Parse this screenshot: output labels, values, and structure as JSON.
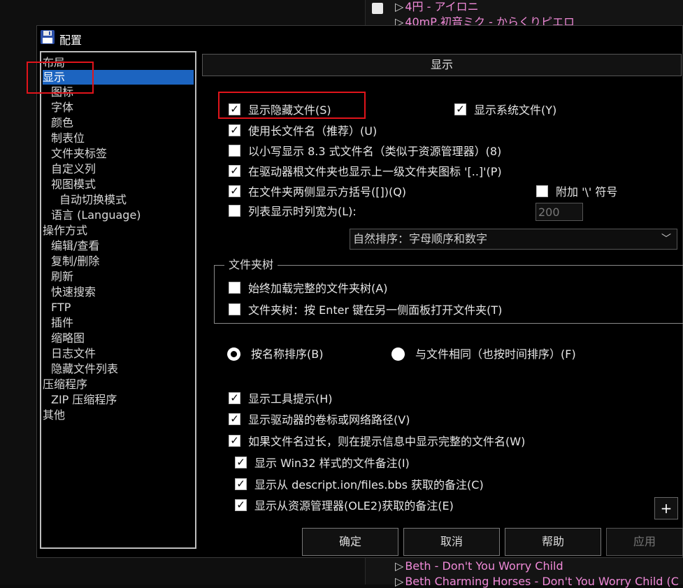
{
  "background": {
    "tracks_top": [
      "4円 - アイロニ",
      "40mP,初音ミク - からくりピエロ"
    ],
    "tracks_bottom": [
      "Beth - Don't You Worry Child",
      "Beth Charming Horses - Don't You Worry Child (C"
    ]
  },
  "dialog": {
    "title": "配置",
    "tree": [
      "布局",
      "显示",
      "图标",
      "字体",
      "颜色",
      "制表位",
      "文件夹标签",
      "自定义列",
      "视图模式",
      "自动切换模式",
      "语言 (Language)",
      "操作方式",
      "编辑/查看",
      "复制/删除",
      "刷新",
      "快速搜索",
      "FTP",
      "插件",
      "缩略图",
      "日志文件",
      "隐藏文件列表",
      "压缩程序",
      "ZIP 压缩程序",
      "其他"
    ],
    "panel_title": "显示",
    "options": {
      "show_hidden": "显示隐藏文件(S)",
      "show_system": "显示系统文件(Y)",
      "long_names": "使用长文件名（推荐）(U)",
      "lowercase_83": "以小写显示 8.3 式文件名（类似于资源管理器）(8)",
      "parent_icon": "在驱动器根文件夹也显示上一级文件夹图标 '[..]'(P)",
      "brackets": "在文件夹两侧显示方括号([])(Q)",
      "append_backslash": "附加 '\\' 符号",
      "col_width": "列表显示时列宽为(L):",
      "col_width_value": "200",
      "sort_mode": "自然排序：字母顺序和数字",
      "tree_group": "文件夹树",
      "tree_full": "始终加载完整的文件夹树(A)",
      "tree_enter": "文件夹树：按 Enter 键在另一侧面板打开文件夹(T)",
      "sort_by_name": "按名称排序(B)",
      "sort_like_files": "与文件相同（也按时间排序）(F)",
      "tooltips": "显示工具提示(H)",
      "volume_labels": "显示驱动器的卷标或网络路径(V)",
      "full_name_tip": "如果文件名过长，则在提示信息中显示完整的文件名(W)",
      "win32_comments": "显示 Win32 样式的文件备注(I)",
      "descript_comments": "显示从 descript.ion/files.bbs 获取的备注(C)",
      "ole2_comments": "显示从资源管理器(OLE2)获取的备注(E)"
    },
    "plus_label": "+",
    "buttons": {
      "ok": "确定",
      "cancel": "取消",
      "help": "帮助",
      "apply": "应用"
    }
  },
  "colors": {
    "selection": "#1c64c0",
    "highlight_annotation": "#e0141b",
    "track_text": "#f08ad8"
  }
}
